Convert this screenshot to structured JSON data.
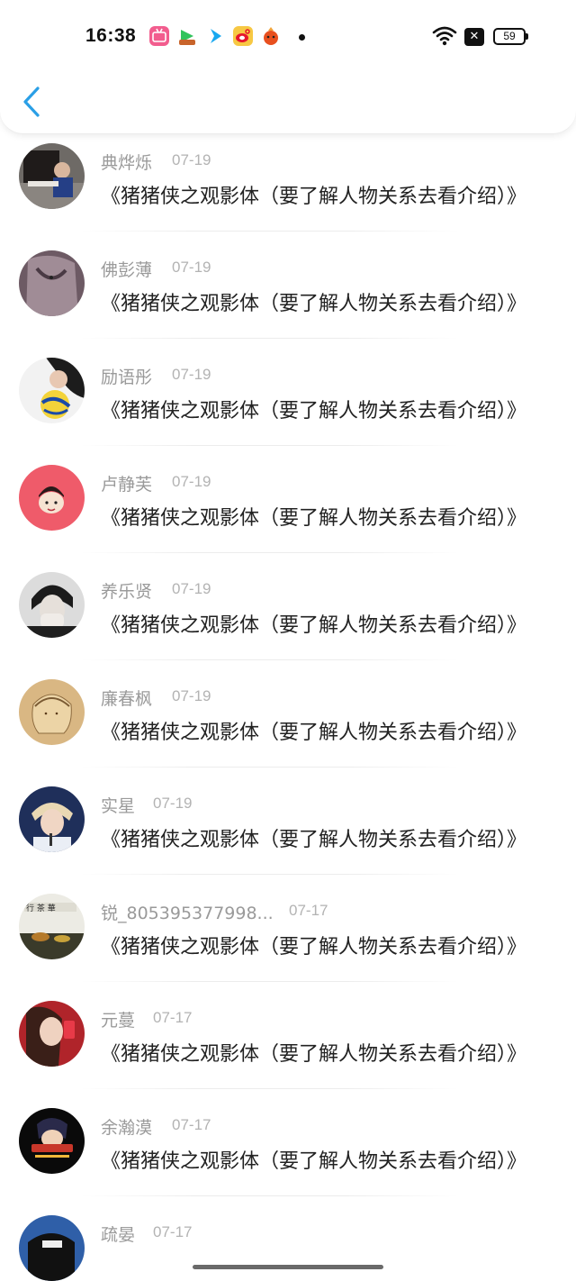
{
  "status_bar": {
    "time": "16:38",
    "battery": "59",
    "notification_icons": [
      "bilibili-icon",
      "video-app-icon",
      "arrow-app-icon",
      "weibo-icon",
      "fire-app-icon"
    ],
    "x_badge": "✕"
  },
  "nav": {
    "back_icon": "chevron-left-icon",
    "back_color": "#2a9fe6"
  },
  "items": [
    {
      "name": "典烨烁",
      "date": "07-19",
      "title": "《猪猪侠之观影体（要了解人物关系去看介绍）》"
    },
    {
      "name": "佛彭薄",
      "date": "07-19",
      "title": "《猪猪侠之观影体（要了解人物关系去看介绍）》"
    },
    {
      "name": "励语彤",
      "date": "07-19",
      "title": "《猪猪侠之观影体（要了解人物关系去看介绍）》"
    },
    {
      "name": "卢静芙",
      "date": "07-19",
      "title": "《猪猪侠之观影体（要了解人物关系去看介绍）》"
    },
    {
      "name": "养乐贤",
      "date": "07-19",
      "title": "《猪猪侠之观影体（要了解人物关系去看介绍）》"
    },
    {
      "name": "廉春枫",
      "date": "07-19",
      "title": "《猪猪侠之观影体（要了解人物关系去看介绍）》"
    },
    {
      "name": "实星",
      "date": "07-19",
      "title": "《猪猪侠之观影体（要了解人物关系去看介绍）》"
    },
    {
      "name": "锐_805395377998...",
      "date": "07-17",
      "title": "《猪猪侠之观影体（要了解人物关系去看介绍）》"
    },
    {
      "name": "元蔓",
      "date": "07-17",
      "title": "《猪猪侠之观影体（要了解人物关系去看介绍）》"
    },
    {
      "name": "余瀚漠",
      "date": "07-17",
      "title": "《猪猪侠之观影体（要了解人物关系去看介绍）》"
    },
    {
      "name": "疏晏",
      "date": "07-17",
      "title": ""
    }
  ]
}
